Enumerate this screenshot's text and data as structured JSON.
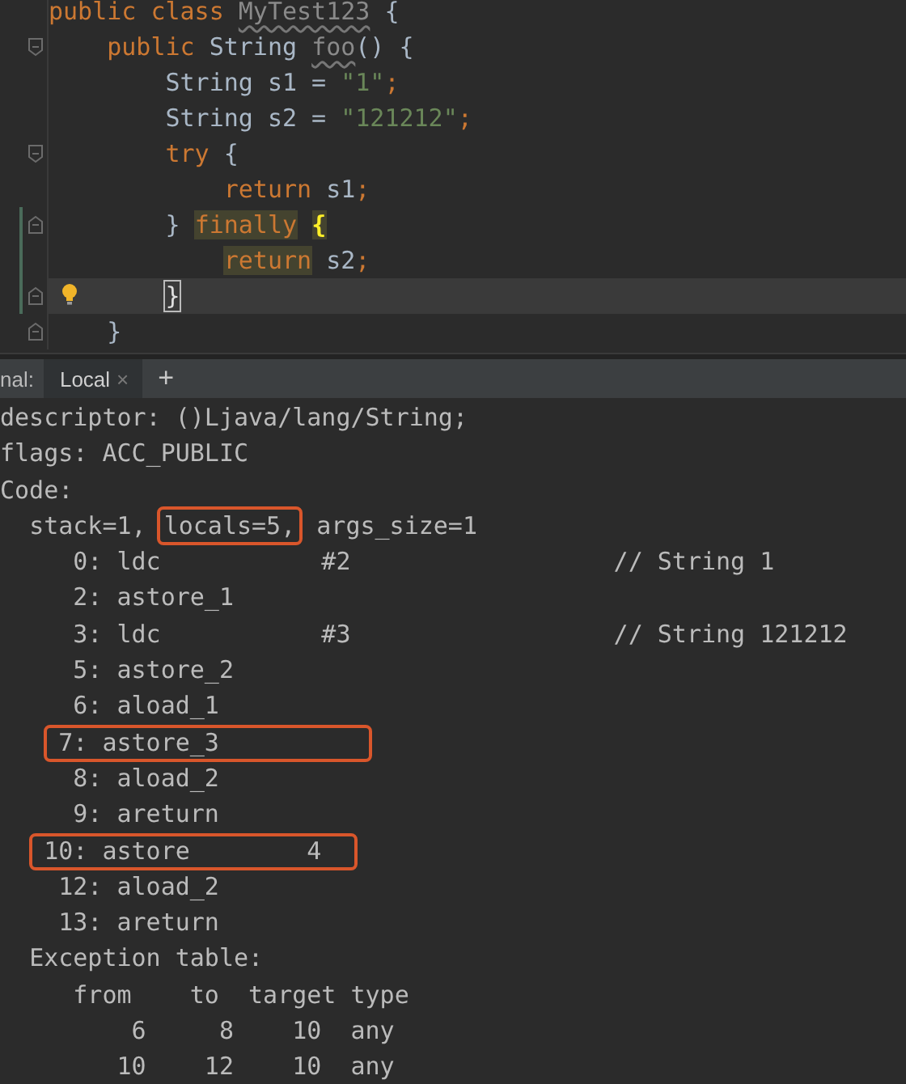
{
  "editor": {
    "lines": [
      {
        "current": false,
        "fold_start": false,
        "fold_end": false,
        "bulb": false,
        "changed": false,
        "tokens": [
          {
            "text": "public class ",
            "kind": "keyword"
          },
          {
            "text": "MyTest123",
            "kind": "unused"
          },
          {
            "text": " {",
            "kind": "plain"
          }
        ]
      },
      {
        "current": false,
        "fold_start": true,
        "fold_end": false,
        "bulb": false,
        "changed": false,
        "tokens": [
          {
            "text": "    public ",
            "kind": "keyword"
          },
          {
            "text": "String ",
            "kind": "plain"
          },
          {
            "text": "foo",
            "kind": "unused"
          },
          {
            "text": "() {",
            "kind": "plain"
          }
        ]
      },
      {
        "current": false,
        "fold_start": false,
        "fold_end": false,
        "bulb": false,
        "changed": false,
        "tokens": [
          {
            "text": "        String s1 = ",
            "kind": "plain"
          },
          {
            "text": "\"1\"",
            "kind": "string"
          },
          {
            "text": ";",
            "kind": "keyword"
          }
        ]
      },
      {
        "current": false,
        "fold_start": false,
        "fold_end": false,
        "bulb": false,
        "changed": false,
        "tokens": [
          {
            "text": "        String s2 = ",
            "kind": "plain"
          },
          {
            "text": "\"121212\"",
            "kind": "string"
          },
          {
            "text": ";",
            "kind": "keyword"
          }
        ]
      },
      {
        "current": false,
        "fold_start": true,
        "fold_end": false,
        "bulb": false,
        "changed": false,
        "tokens": [
          {
            "text": "        try",
            "kind": "keyword"
          },
          {
            "text": " {",
            "kind": "plain"
          }
        ]
      },
      {
        "current": false,
        "fold_start": false,
        "fold_end": false,
        "bulb": false,
        "changed": false,
        "tokens": [
          {
            "text": "            return",
            "kind": "keyword"
          },
          {
            "text": " s1",
            "kind": "plain"
          },
          {
            "text": ";",
            "kind": "keyword"
          }
        ]
      },
      {
        "current": false,
        "fold_start": false,
        "fold_end": true,
        "bulb": false,
        "changed": true,
        "tokens": [
          {
            "text": "        } ",
            "kind": "plain"
          },
          {
            "text": "finally",
            "kind": "keyword-hl"
          },
          {
            "text": " {",
            "kind": "brace-hl"
          }
        ]
      },
      {
        "current": false,
        "fold_start": false,
        "fold_end": false,
        "bulb": false,
        "changed": true,
        "tokens": [
          {
            "text": "            return",
            "kind": "keyword-hl"
          },
          {
            "text": " s2",
            "kind": "plain"
          },
          {
            "text": ";",
            "kind": "keyword"
          }
        ]
      },
      {
        "current": true,
        "fold_start": false,
        "fold_end": true,
        "bulb": true,
        "changed": true,
        "tokens": [
          {
            "text": "        }",
            "kind": "caret-brace"
          }
        ]
      },
      {
        "current": false,
        "fold_start": false,
        "fold_end": true,
        "bulb": false,
        "changed": false,
        "tokens": [
          {
            "text": "    }",
            "kind": "plain"
          }
        ]
      }
    ]
  },
  "terminal": {
    "caption": "nal:",
    "tabs": [
      {
        "label": "Local",
        "selected": true,
        "close": "×"
      }
    ],
    "add_button": "+",
    "lines": [
      {
        "segments": [
          {
            "text": "descriptor: ()Ljava/lang/String;",
            "boxed": false
          }
        ]
      },
      {
        "segments": [
          {
            "text": "flags: ACC_PUBLIC",
            "boxed": false
          }
        ]
      },
      {
        "segments": [
          {
            "text": "Code:",
            "boxed": false
          }
        ]
      },
      {
        "segments": [
          {
            "text": "  stack=1, ",
            "boxed": false
          },
          {
            "text": "locals=5,",
            "boxed": true
          },
          {
            "text": " args_size=1",
            "boxed": false
          }
        ]
      },
      {
        "segments": [
          {
            "text": "     0: ldc           #2                  // String 1",
            "boxed": false
          }
        ]
      },
      {
        "segments": [
          {
            "text": "     2: astore_1",
            "boxed": false
          }
        ]
      },
      {
        "segments": [
          {
            "text": "     3: ldc           #3                  // String 121212",
            "boxed": false
          }
        ]
      },
      {
        "segments": [
          {
            "text": "     5: astore_2",
            "boxed": false
          }
        ]
      },
      {
        "segments": [
          {
            "text": "     6: aload_1",
            "boxed": false
          }
        ]
      },
      {
        "segments": [
          {
            "text": "    7: astore_3",
            "boxed": true
          }
        ]
      },
      {
        "segments": [
          {
            "text": "     8: aload_2",
            "boxed": false
          }
        ]
      },
      {
        "segments": [
          {
            "text": "     9: areturn",
            "boxed": false
          }
        ]
      },
      {
        "segments": [
          {
            "text": "   10: astore        4",
            "boxed": true
          }
        ]
      },
      {
        "segments": [
          {
            "text": "    12: aload_2",
            "boxed": false
          }
        ]
      },
      {
        "segments": [
          {
            "text": "    13: areturn",
            "boxed": false
          }
        ]
      },
      {
        "segments": [
          {
            "text": "  Exception table:",
            "boxed": false
          }
        ]
      },
      {
        "segments": [
          {
            "text": "     from    to  target type",
            "boxed": false
          }
        ]
      },
      {
        "segments": [
          {
            "text": "         6     8    10  any",
            "boxed": false
          }
        ]
      },
      {
        "segments": [
          {
            "text": "        10    12    10  any",
            "boxed": false
          }
        ]
      }
    ]
  }
}
